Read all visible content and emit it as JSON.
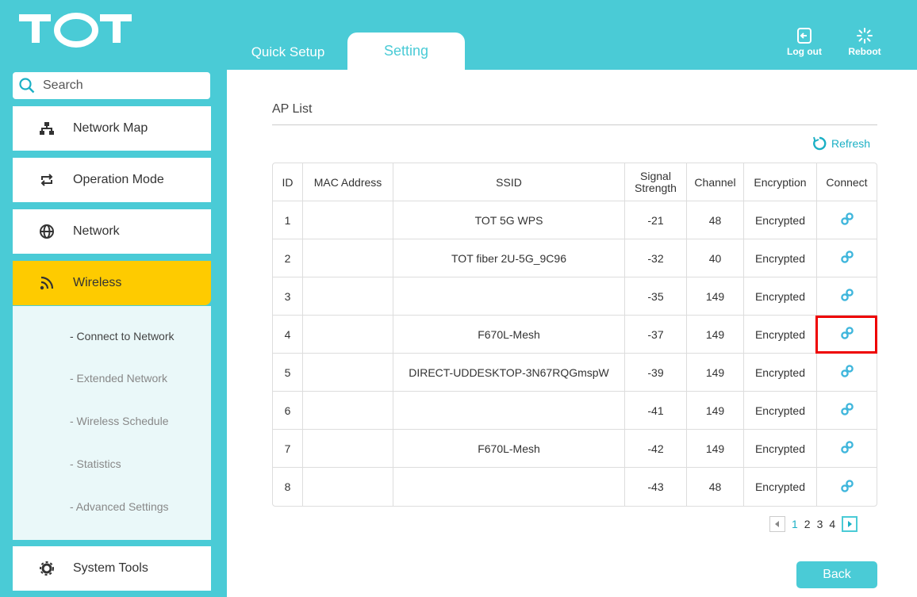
{
  "brand": {
    "logo_text": "TOT"
  },
  "header": {
    "tabs": [
      {
        "label": "Quick Setup"
      },
      {
        "label": "Setting"
      }
    ],
    "logout_label": "Log out",
    "reboot_label": "Reboot"
  },
  "sidebar": {
    "search_placeholder": "Search",
    "items": [
      {
        "label": "Network Map",
        "icon": "network-map-icon"
      },
      {
        "label": "Operation Mode",
        "icon": "operation-mode-icon"
      },
      {
        "label": "Network",
        "icon": "globe-icon"
      },
      {
        "label": "Wireless",
        "icon": "wireless-icon",
        "active": true
      },
      {
        "label": "System Tools",
        "icon": "gear-icon"
      }
    ],
    "wireless_sub": [
      {
        "label": "- Connect to Network",
        "current": true
      },
      {
        "label": "- Extended Network"
      },
      {
        "label": "- Wireless Schedule"
      },
      {
        "label": "- Statistics"
      },
      {
        "label": "- Advanced Settings"
      }
    ]
  },
  "main": {
    "title": "AP List",
    "refresh_label": "Refresh",
    "columns": [
      "ID",
      "MAC Address",
      "SSID",
      "Signal Strength",
      "Channel",
      "Encryption",
      "Connect"
    ],
    "rows": [
      {
        "id": "1",
        "ssid": "TOT 5G WPS",
        "signal": "-21",
        "channel": "48",
        "encryption": "Encrypted"
      },
      {
        "id": "2",
        "ssid": "TOT fiber 2U-5G_9C96",
        "signal": "-32",
        "channel": "40",
        "encryption": "Encrypted"
      },
      {
        "id": "3",
        "ssid": "",
        "signal": "-35",
        "channel": "149",
        "encryption": "Encrypted"
      },
      {
        "id": "4",
        "ssid": "F670L-Mesh",
        "signal": "-37",
        "channel": "149",
        "encryption": "Encrypted"
      },
      {
        "id": "5",
        "ssid": "DIRECT-UDDESKTOP-3N67RQGmspW",
        "signal": "-39",
        "channel": "149",
        "encryption": "Encrypted"
      },
      {
        "id": "6",
        "ssid": "",
        "signal": "-41",
        "channel": "149",
        "encryption": "Encrypted"
      },
      {
        "id": "7",
        "ssid": "F670L-Mesh",
        "signal": "-42",
        "channel": "149",
        "encryption": "Encrypted"
      },
      {
        "id": "8",
        "ssid": "",
        "signal": "-43",
        "channel": "48",
        "encryption": "Encrypted"
      }
    ],
    "pagination": {
      "pages": [
        "1",
        "2",
        "3",
        "4"
      ],
      "current": "1"
    },
    "back_label": "Back"
  },
  "colors": {
    "accent": "#4acbd6",
    "active": "#fecb00",
    "link": "#1bb0c5",
    "highlight": "#e00000"
  }
}
